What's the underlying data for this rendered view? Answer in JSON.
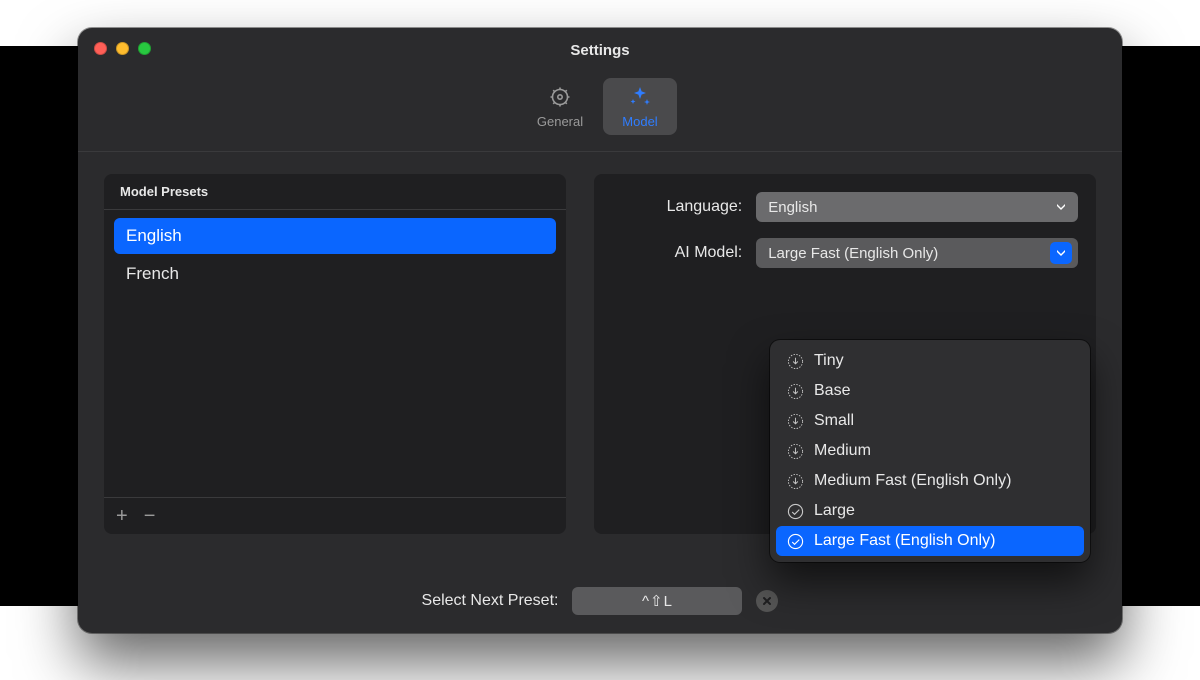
{
  "window": {
    "title": "Settings"
  },
  "tabs": [
    {
      "id": "general",
      "label": "General",
      "selected": false
    },
    {
      "id": "model",
      "label": "Model",
      "selected": true
    }
  ],
  "presets": {
    "header": "Model Presets",
    "items": [
      {
        "label": "English",
        "selected": true
      },
      {
        "label": "French",
        "selected": false
      }
    ],
    "actions": {
      "add": "+",
      "remove": "−"
    }
  },
  "form": {
    "language": {
      "label": "Language:",
      "value": "English"
    },
    "ai_model": {
      "label": "AI Model:",
      "value": "Large Fast (English Only)",
      "menu_open": true,
      "options": [
        {
          "label": "Tiny",
          "status": "download"
        },
        {
          "label": "Base",
          "status": "download"
        },
        {
          "label": "Small",
          "status": "download"
        },
        {
          "label": "Medium",
          "status": "download"
        },
        {
          "label": "Medium Fast (English Only)",
          "status": "download"
        },
        {
          "label": "Large",
          "status": "installed"
        },
        {
          "label": "Large Fast (English Only)",
          "status": "installed",
          "selected": true
        }
      ]
    }
  },
  "footer": {
    "label": "Select Next Preset:",
    "shortcut": "^⇧L"
  }
}
